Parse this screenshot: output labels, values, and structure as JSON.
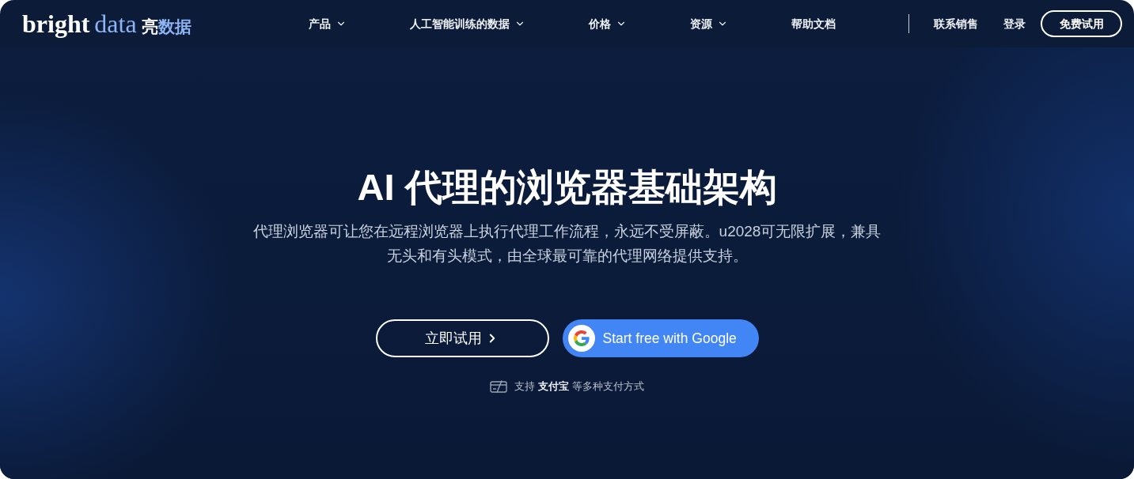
{
  "nav": {
    "logo": {
      "word_1": "bright",
      "word_2": "data",
      "cjk_1": "亮",
      "cjk_2": "数据"
    },
    "menu": [
      {
        "label": "产品",
        "dropdown": true
      },
      {
        "label": "人工智能训练的数据",
        "dropdown": true
      },
      {
        "label": "价格",
        "dropdown": true
      },
      {
        "label": "资源",
        "dropdown": true
      },
      {
        "label": "帮助文档",
        "dropdown": false
      }
    ],
    "actions": [
      {
        "label": "联系销售",
        "kind": "link"
      },
      {
        "label": "登录",
        "kind": "link"
      },
      {
        "label": "免费试用",
        "kind": "outline"
      }
    ]
  },
  "hero": {
    "title": "AI 代理的浏览器基础架构",
    "subtitle": "代理浏览器可让您在远程浏览器上执行代理工作流程，永远不受屏蔽。u2028可无限扩展，兼具无头和有头模式，由全球最可靠的代理网络提供支持。",
    "buttons": [
      {
        "label": "立即试用",
        "kind": "outline"
      },
      {
        "label": "Start free with Google",
        "kind": "google"
      }
    ],
    "payment_note": "支持 **支付宝** 等多种支付方式"
  }
}
